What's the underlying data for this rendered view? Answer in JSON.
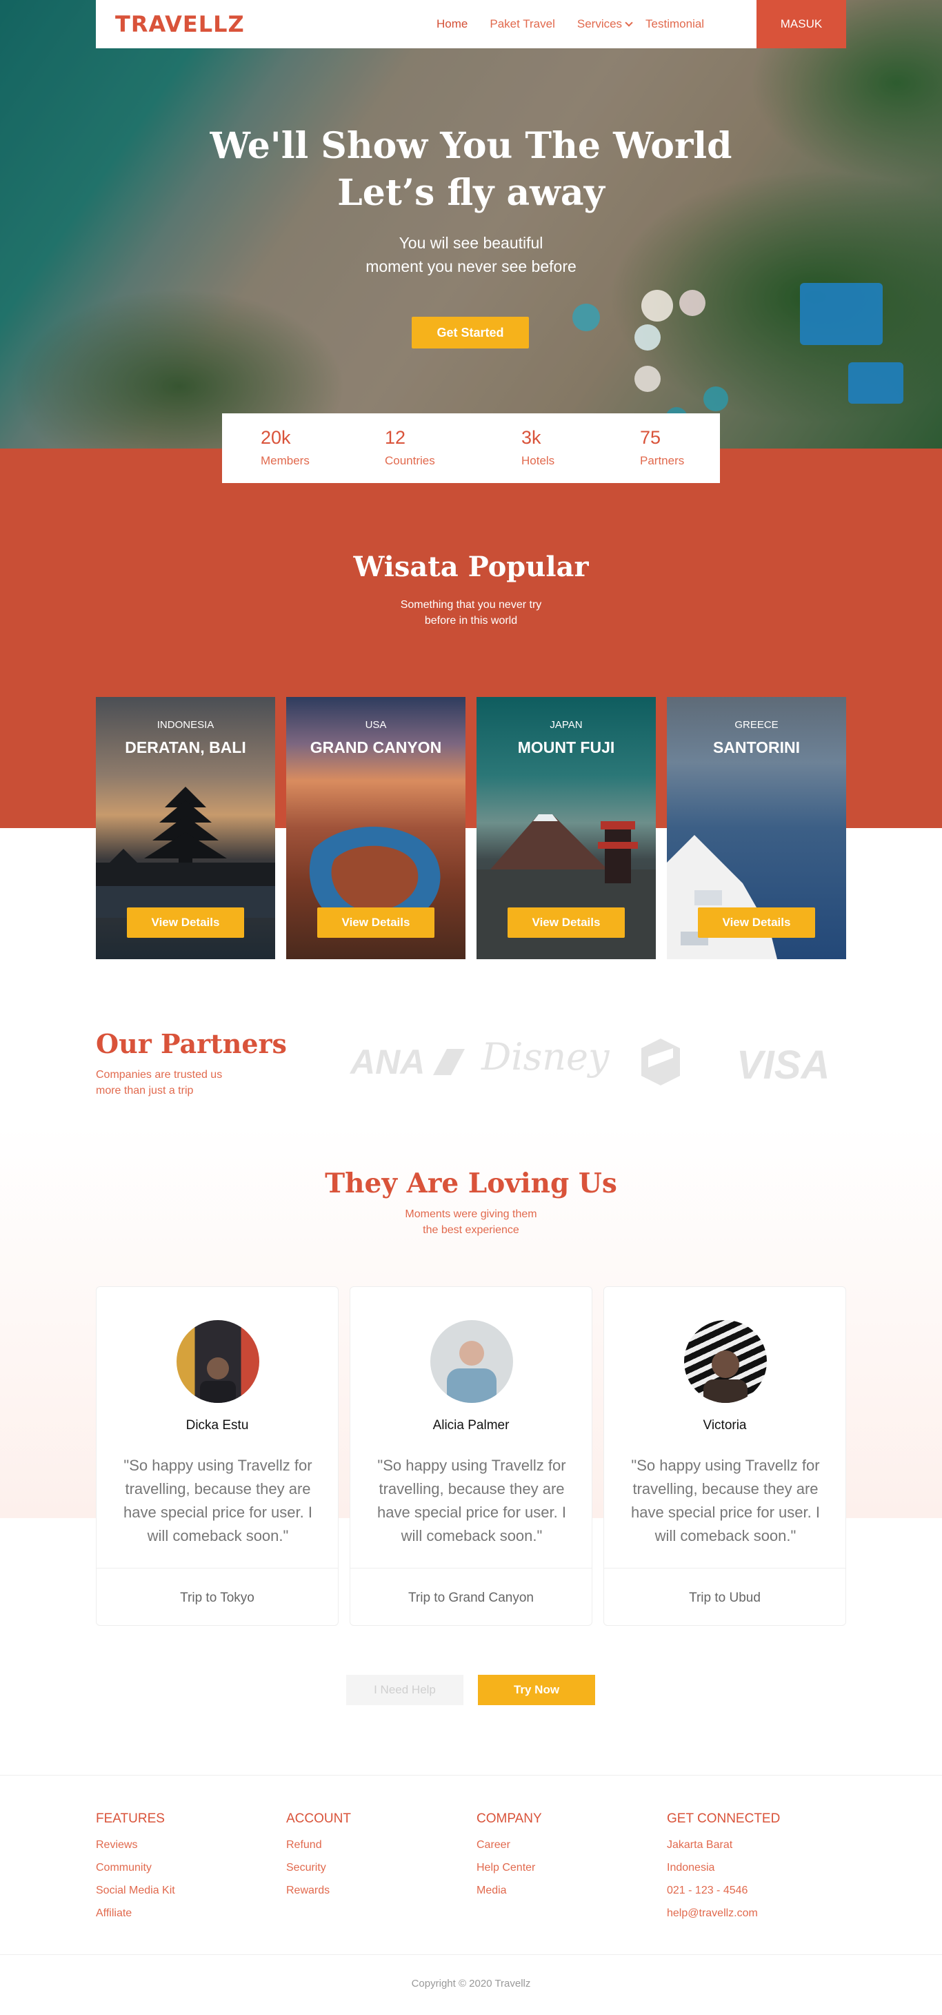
{
  "nav": {
    "logo": "TRAVELLZ",
    "links": [
      "Home",
      "Paket Travel",
      "Services",
      "Testimonial"
    ],
    "login": "MASUK"
  },
  "hero": {
    "title_line1": "We'll Show You The World",
    "title_line2": "Let’s fly away",
    "subtitle_line1": "You wil see beautiful",
    "subtitle_line2": "moment you never see before",
    "cta": "Get Started"
  },
  "stats": [
    {
      "value": "20k",
      "label": "Members"
    },
    {
      "value": "12",
      "label": "Countries"
    },
    {
      "value": "3k",
      "label": "Hotels"
    },
    {
      "value": "75",
      "label": "Partners"
    }
  ],
  "popular": {
    "title": "Wisata Popular",
    "subtitle_line1": "Something that you never try",
    "subtitle_line2": "before in this world",
    "cards": [
      {
        "country": "INDONESIA",
        "place": "DERATAN, BALI",
        "button": "View Details"
      },
      {
        "country": "USA",
        "place": "GRAND CANYON",
        "button": "View Details"
      },
      {
        "country": "JAPAN",
        "place": "MOUNT FUJI",
        "button": "View Details"
      },
      {
        "country": "GREECE",
        "place": "SANTORINI",
        "button": "View Details"
      }
    ]
  },
  "partners": {
    "title": "Our Partners",
    "subtitle_line1": "Companies are trusted us",
    "subtitle_line2": "more than just a trip",
    "logos": [
      "ANA",
      "Disney",
      "VISA"
    ]
  },
  "testimonials": {
    "title": "They Are Loving Us",
    "subtitle_line1": "Moments were giving them",
    "subtitle_line2": "the best experience",
    "items": [
      {
        "name": "Dicka Estu",
        "quote": "\"So happy using Travellz for travelling, because they are have special price for user. I will comeback soon.\"",
        "trip": "Trip to Tokyo"
      },
      {
        "name": "Alicia Palmer",
        "quote": "\"So happy using Travellz for travelling, because they are have special price for user. I will comeback soon.\"",
        "trip": "Trip to Grand Canyon"
      },
      {
        "name": "Victoria",
        "quote": "\"So happy using Travellz for travelling, because they are have special price for user. I will comeback soon.\"",
        "trip": "Trip to Ubud"
      }
    ]
  },
  "cta": {
    "help": "I Need Help",
    "try": "Try Now"
  },
  "footer": {
    "columns": [
      {
        "title": "FEATURES",
        "items": [
          "Reviews",
          "Community",
          "Social Media Kit",
          "Affiliate"
        ]
      },
      {
        "title": "ACCOUNT",
        "items": [
          "Refund",
          "Security",
          "Rewards"
        ]
      },
      {
        "title": "COMPANY",
        "items": [
          "Career",
          "Help Center",
          "Media"
        ]
      },
      {
        "title": "GET CONNECTED",
        "items": [
          "Jakarta Barat",
          "Indonesia",
          "021 - 123 - 4546",
          "help@travellz.com"
        ]
      }
    ],
    "copyright": "Copyright © 2020 Travellz"
  },
  "colors": {
    "primary": "#d9533a",
    "accent": "#f6b21b"
  }
}
